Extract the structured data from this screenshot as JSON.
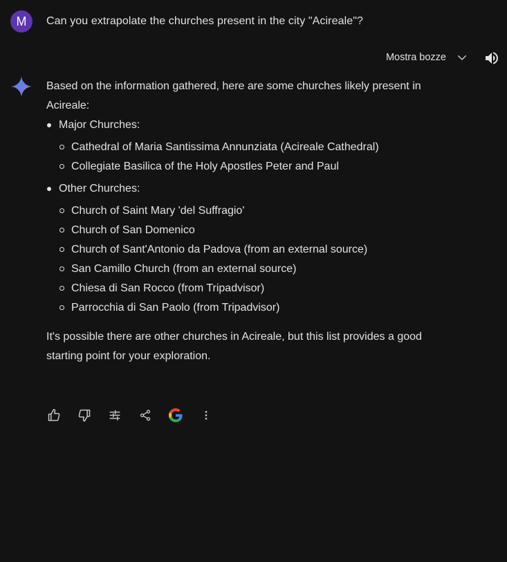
{
  "user": {
    "avatar_initial": "M",
    "prompt": "Can you extrapolate the churches present in the city \"Acireale\"?"
  },
  "drafts": {
    "label": "Mostra bozze"
  },
  "response": {
    "intro": "Based on the information gathered, here are some churches likely present in Acireale:",
    "sections": [
      {
        "heading": "Major Churches:",
        "items": [
          "Cathedral of Maria Santissima Annunziata (Acireale Cathedral)",
          "Collegiate Basilica of the Holy Apostles Peter and Paul"
        ]
      },
      {
        "heading": "Other Churches:",
        "items": [
          "Church of Saint Mary 'del Suffragio'",
          "Church of San Domenico",
          "Church of Sant'Antonio da Padova (from an external source)",
          "San Camillo Church (from an external source)",
          "Chiesa di San Rocco (from Tripadvisor)",
          "Parrocchia di San Paolo (from Tripadvisor)"
        ]
      }
    ],
    "closing": "It's possible there are other churches in Acireale, but this list provides a good starting point for your exploration."
  },
  "actions": [
    "thumbs-up-icon",
    "thumbs-down-icon",
    "tune-icon",
    "share-icon",
    "google-icon",
    "more-vert-icon"
  ],
  "colors": {
    "background": "#131314",
    "text": "#e3e3e3",
    "avatar": "#5e35b1",
    "spark_start": "#4285f4",
    "spark_end": "#9b72cb"
  }
}
